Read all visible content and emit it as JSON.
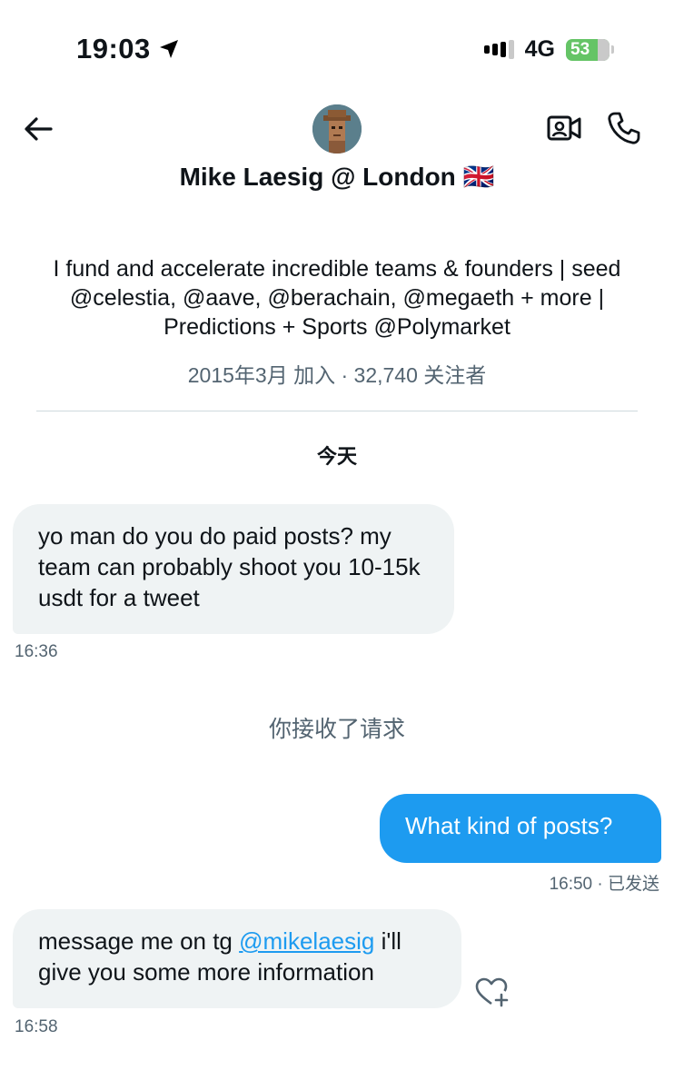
{
  "status_bar": {
    "time": "19:03",
    "network": "4G",
    "battery": "53",
    "icons": [
      "location-arrow-icon",
      "signal-icon",
      "battery-charging-icon"
    ]
  },
  "header": {
    "name": "Mike Laesig @ London 🇬🇧",
    "icons": [
      "back-arrow-icon",
      "avatar",
      "video-call-icon",
      "phone-call-icon"
    ]
  },
  "profile": {
    "bio": "I fund and accelerate incredible teams & founders | seed @celestia, @aave, @berachain, @megaeth + more | Predictions + Sports @Polymarket",
    "meta": "2015年3月 加入 · 32,740 关注者"
  },
  "conversation": {
    "day_label": "今天",
    "messages": [
      {
        "direction": "incoming",
        "text": "yo man do you do paid posts? my team can probably shoot you 10-15k usdt for a tweet",
        "time": "16:36"
      },
      {
        "direction": "outgoing",
        "text": "What kind of posts?",
        "time": "16:50 · 已发送"
      },
      {
        "direction": "incoming",
        "text_before": "message me on tg ",
        "mention": "@mikelaesig",
        "text_after": " i'll give you some more information",
        "time": "16:58"
      }
    ],
    "system_note": "你接收了请求"
  },
  "colors": {
    "accent": "#1d9bf0",
    "incoming_bubble": "#eff3f4",
    "secondary_text": "#536471",
    "battery": "#65c466"
  }
}
